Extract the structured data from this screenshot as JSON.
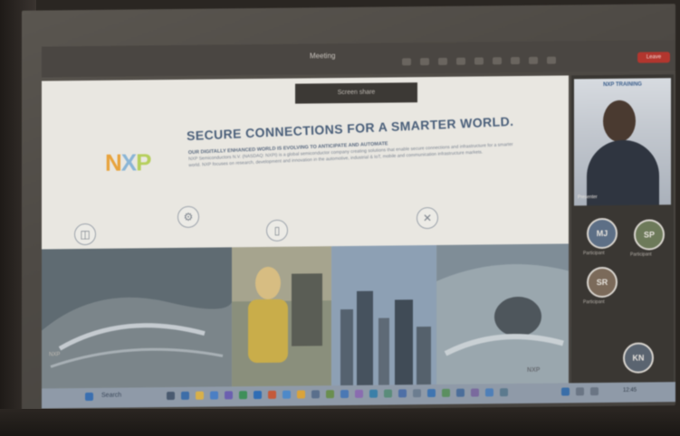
{
  "meeting": {
    "title": "Meeting",
    "leave_label": "Leave",
    "slide_topbar_text": "Screen share"
  },
  "slide": {
    "brand": {
      "n": "N",
      "x": "X",
      "p": "P"
    },
    "headline": "SECURE CONNECTIONS FOR A SMARTER WORLD.",
    "lead": "OUR DIGITALLY ENHANCED WORLD IS EVOLVING TO ANTICIPATE AND AUTOMATE",
    "body": "NXP Semiconductors N.V. (NASDAQ: NXPI) is a global semiconductor company creating solutions that enable secure connections and infrastructure for a smarter world. NXP focuses on research, development and innovation in the automotive, industrial & IoT, mobile and communication infrastructure markets.",
    "icons": [
      "gear-icon",
      "mobile-icon",
      "tools-icon",
      "car-icon"
    ],
    "footer": "NXP",
    "corner_text": "NXP"
  },
  "participants": {
    "speaker_banner": "NXP  TRAINING",
    "speaker_name": "Presenter",
    "avatars": [
      {
        "initials": "MJ",
        "name": "Participant"
      },
      {
        "initials": "SP",
        "name": "Participant"
      },
      {
        "initials": "SR",
        "name": "Participant"
      },
      {
        "initials": "KN",
        "name": "Participant"
      }
    ]
  },
  "taskbar": {
    "search_label": "Search",
    "clock": "12:45"
  },
  "colors": {
    "leave": "#b2362e",
    "headline": "#4a5f7a",
    "taskbar": "#8f9aa8"
  }
}
